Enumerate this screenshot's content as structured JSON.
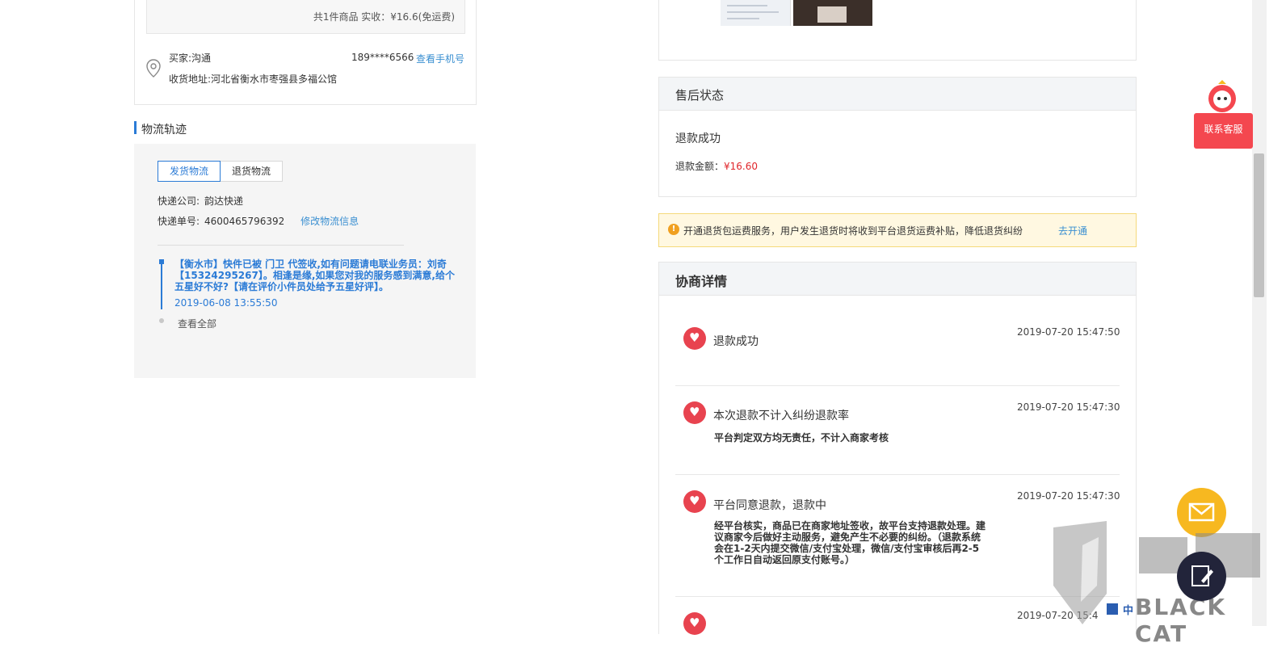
{
  "order": {
    "summary": "共1件商品    实收：¥16.6(免运费)",
    "buyer": "买家:沟通",
    "phone": "189****6566",
    "view_phone": "查看手机号",
    "address": "收货地址:河北省衡水市枣强县多福公馆"
  },
  "logistics": {
    "title": "物流轨迹",
    "tabs": [
      "发货物流",
      "退货物流"
    ],
    "company_label": "快递公司:",
    "company": "韵达快递",
    "number_label": "快递单号:",
    "number": "4600465796392",
    "edit_link": "修改物流信息",
    "track_text": "【衡水市】快件已被 门卫 代签收,如有问题请电联业务员：刘奇【15324295267】。相逢是缘,如果您对我的服务感到满意,给个五星好不好?【请在评价小件员处给予五星好评】。",
    "track_time": "2019-06-08 13:55:50",
    "view_all": "查看全部"
  },
  "after_sale": {
    "title": "售后状态",
    "status": "退款成功",
    "amount_label": "退款金额：",
    "amount": "¥16.60"
  },
  "notice": {
    "text": "开通退货包运费服务，用户发生退货时将收到平台退货运费补贴，降低退货纠纷",
    "link": "去开通"
  },
  "negotiation": {
    "title": "协商详情",
    "items": [
      {
        "title": "退款成功",
        "time": "2019-07-20 15:47:50",
        "desc": ""
      },
      {
        "title": "本次退款不计入纠纷退款率",
        "time": "2019-07-20 15:47:30",
        "desc": "平台判定双方均无责任，不计入商家考核"
      },
      {
        "title": "平台同意退款，退款中",
        "time": "2019-07-20 15:47:30",
        "desc": "经平台核实，商品已在商家地址签收，故平台支持退款处理。建议商家今后做好主动服务，避免产生不必要的纠纷。（退款系统会在1-2天内提交微信/支付宝处理，微信/支付宝审核后再2-5个工作日自动返回原支付账号。）"
      },
      {
        "title": "",
        "time": "2019-07-20 15:4",
        "desc": ""
      }
    ]
  },
  "widgets": {
    "service": "联系客服",
    "watermark": "BLACK CAT",
    "ime": "中"
  },
  "colors": {
    "accent": "#2b7bd6",
    "price": "#e0262b",
    "service": "#f4474f",
    "mail": "#f7b820"
  }
}
